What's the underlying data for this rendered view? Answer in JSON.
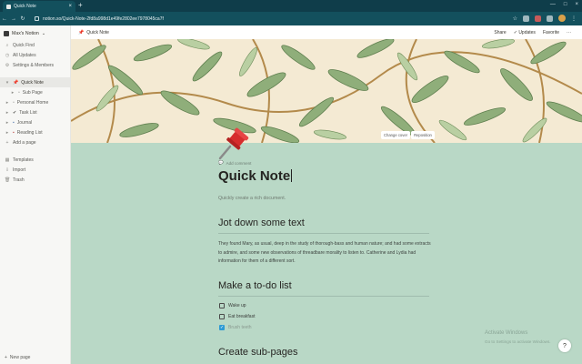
{
  "browser": {
    "tab_title": "Quick Note",
    "tab_close": "×",
    "new_tab": "+",
    "url": "notion.so/Quick-Note-2fd8a998d1e49fe2802ee7978045ca7f",
    "win_min": "—",
    "win_max": "□",
    "win_close": "×"
  },
  "sidebar": {
    "workspace": "Max's Notion",
    "items": [
      {
        "label": "Quick Find",
        "icon": "search-icon",
        "glyph": "⌕"
      },
      {
        "label": "All Updates",
        "icon": "clock-icon",
        "glyph": "◷"
      },
      {
        "label": "Settings & Members",
        "icon": "gear-icon",
        "glyph": "⚙"
      }
    ],
    "pages": [
      {
        "label": "Quick Note",
        "glyph": "📌",
        "active": true
      },
      {
        "label": "Sub Page",
        "glyph": "▫",
        "child": true
      },
      {
        "label": "Personal Home",
        "glyph": "▫"
      },
      {
        "label": "Task List",
        "glyph": "✔"
      },
      {
        "label": "Journal",
        "glyph": "▪"
      },
      {
        "label": "Reading List",
        "glyph": "▪"
      }
    ],
    "add_page": "Add a page",
    "utils": [
      {
        "label": "Templates",
        "glyph": "▦"
      },
      {
        "label": "Import",
        "glyph": "⇩"
      },
      {
        "label": "Trash",
        "glyph": "🗑"
      }
    ],
    "new_page": "New page"
  },
  "topbar": {
    "crumb": "Quick Note",
    "share": "Share",
    "updates": "Updates",
    "favorite": "Favorite",
    "more": "···"
  },
  "cover": {
    "change_cover": "Change cover",
    "reposition": "Reposition"
  },
  "page": {
    "add_comment": "Add comment",
    "title": "Quick Note",
    "subtitle": "Quickly create a rich document.",
    "h_text": "Jot down some text",
    "paragraph": "They found Mary, as usual, deep in the study of thorough-bass and human nature; and had some extracts to admire, and some new observations of threadbare morality to listen to. Catherine and Lydia had information for them of a different sort.",
    "h_todo": "Make a to-do list",
    "todos": [
      {
        "label": "Wake up",
        "done": false
      },
      {
        "label": "Eat breakfast",
        "done": false
      },
      {
        "label": "Brush teeth",
        "done": true
      }
    ],
    "h_sub": "Create sub-pages"
  },
  "watermark": {
    "line1": "Activate Windows",
    "line2": "Go to Settings to activate Windows."
  },
  "help": "?",
  "colors": {
    "page_bg": "#b9d8c6",
    "chrome": "#13505d",
    "sidebar_bg": "#f7f7f5",
    "checkbox_checked": "#2e9bd4"
  }
}
